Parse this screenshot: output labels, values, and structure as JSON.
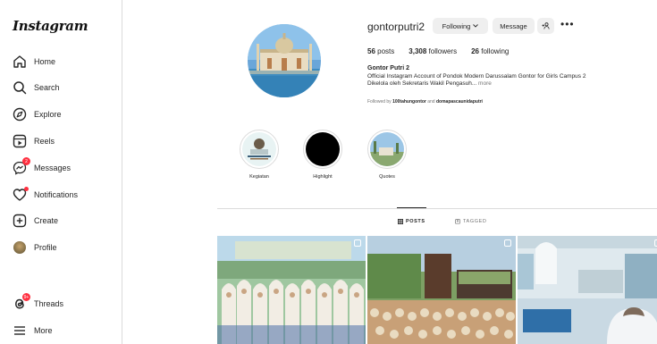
{
  "sidebar": {
    "logo": "Instagram",
    "items": [
      {
        "label": "Home"
      },
      {
        "label": "Search"
      },
      {
        "label": "Explore"
      },
      {
        "label": "Reels"
      },
      {
        "label": "Messages",
        "badge": "2"
      },
      {
        "label": "Notifications"
      },
      {
        "label": "Create"
      },
      {
        "label": "Profile"
      },
      {
        "label": "Threads",
        "badge": "9+"
      },
      {
        "label": "More"
      }
    ]
  },
  "profile": {
    "username": "gontorputri2",
    "following_button": "Following",
    "message_button": "Message",
    "stats": {
      "posts_count": "56",
      "posts_label": "posts",
      "followers_count": "3,308",
      "followers_label": "followers",
      "following_count": "26",
      "following_label": "following"
    },
    "full_name": "Gontor Putri 2",
    "bio_line1": "Official Instagram Account of Pondok Modern Darussalam Gontor for Girls Campus 2",
    "bio_line2": "Dikelola oleh Sekretaris Wakil Pengasuh...",
    "bio_more": "more",
    "followed_by_prefix": "Followed by",
    "followed_by_1": "100tahungontor",
    "followed_by_and": "and",
    "followed_by_2": "domapascaunidaputri"
  },
  "highlights": [
    {
      "label": "Kegiatan"
    },
    {
      "label": "Highlight"
    },
    {
      "label": "Quotes"
    }
  ],
  "tabs": {
    "posts": "POSTS",
    "tagged": "TAGGED"
  },
  "colors": {
    "accent": "#0095f6",
    "badge": "#ff3040",
    "button_bg": "#efefef"
  }
}
